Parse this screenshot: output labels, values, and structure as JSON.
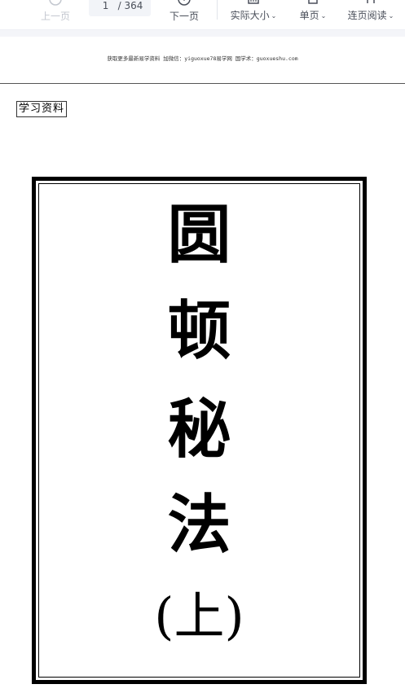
{
  "toolbar": {
    "prev_label": "上一页",
    "current_page": "1",
    "total_pages": "/ 364",
    "next_label": "下一页",
    "actual_size_label": "实际大小",
    "single_page_label": "单页",
    "continuous_label": "连页阅读"
  },
  "document": {
    "header_note": "获取更多最新易学资料 加微信：yiguoxue78易学网 国学术：guoxueshu.com",
    "tag": "学习资料",
    "cover_chars": [
      "圆",
      "顿",
      "秘",
      "法",
      "(上)"
    ]
  }
}
